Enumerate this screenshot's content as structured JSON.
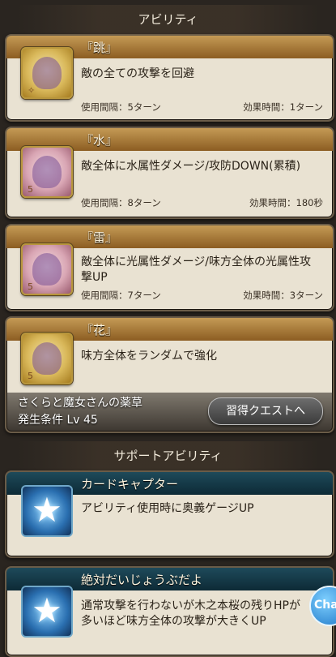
{
  "sections": {
    "abilities_title": "アビリティ",
    "support_title": "サポートアビリティ"
  },
  "abilities": [
    {
      "name": "『跳』",
      "desc": "敵の全ての攻撃を回避",
      "cooldown": "使用間隔：5ターン",
      "duration": "効果時間：1ターン",
      "icon": "jump-ability-icon"
    },
    {
      "name": "『水』",
      "desc": "敵全体に水属性ダメージ/攻防DOWN(累積)",
      "cooldown": "使用間隔：8ターン",
      "duration": "効果時間：180秒",
      "icon": "water-ability-icon"
    },
    {
      "name": "『雷』",
      "desc": "敵全体に光属性ダメージ/味方全体の光属性攻撃UP",
      "cooldown": "使用間隔：7ターン",
      "duration": "効果時間：3ターン",
      "icon": "thunder-ability-icon"
    },
    {
      "name": "『花』",
      "desc": "味方全体をランダムで強化",
      "icon": "flower-ability-icon"
    }
  ],
  "unlock": {
    "quest_name": "さくらと魔女さんの薬草",
    "condition": "発生条件 Lv 45",
    "button": "習得クエストへ"
  },
  "support": [
    {
      "name": "カードキャプター",
      "desc": "アビリティ使用時に奥義ゲージUP",
      "icon": "star-icon"
    },
    {
      "name": "絶対だいじょうぶだよ",
      "desc": "通常攻撃を行わないが木之本桜の残りHPが多いほど味方全体の攻撃が大きくUP",
      "icon": "star-icon"
    }
  ],
  "chat_label": "Chat"
}
